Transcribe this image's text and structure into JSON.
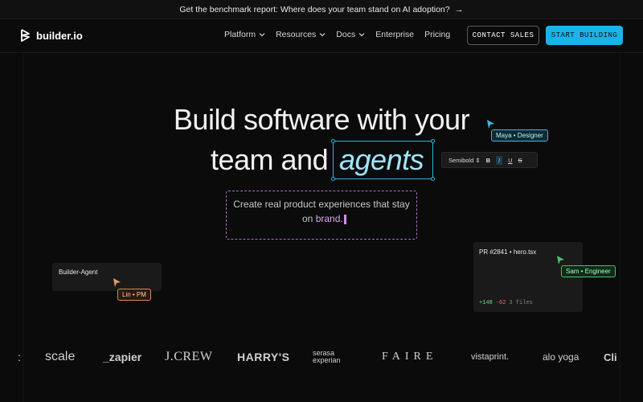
{
  "banner": {
    "text": "Get the benchmark report: Where does your team stand on AI adoption?",
    "arrow_icon": "arrow-right-icon"
  },
  "nav": {
    "brand": "builder.io",
    "items": [
      {
        "label": "Platform",
        "dropdown": true
      },
      {
        "label": "Resources",
        "dropdown": true
      },
      {
        "label": "Docs",
        "dropdown": true
      },
      {
        "label": "Enterprise",
        "dropdown": false
      },
      {
        "label": "Pricing",
        "dropdown": false
      }
    ],
    "contact_label": "CONTACT SALES",
    "start_label": "START BUILDING"
  },
  "hero": {
    "line1": "Build software with your",
    "line2_prefix": "team and",
    "highlight": "agents",
    "subtitle_line1": "Create real product experiences that stay",
    "subtitle_line2_prefix": "on",
    "subtitle_brand": "brand."
  },
  "collaborators": {
    "maya": "Maya • Designer",
    "lin": "Lin • PM",
    "sam": "Sam • Engineer"
  },
  "toolbar": {
    "font_weight": "Semibold",
    "bold": "B",
    "italic": "I",
    "underline": "U",
    "strike": "S"
  },
  "agent_card": {
    "title": "Builder-Agent"
  },
  "pr_card": {
    "title": "PR #2841 • hero.tsx",
    "additions": "+148",
    "deletions": "-62",
    "files": "3 files"
  },
  "logos": [
    "scale",
    "_zapier",
    "J.CREW",
    "HARRY'S",
    "serasa",
    "experian",
    "FAIRE",
    "vistaprint.",
    "alo yoga",
    "Cli"
  ],
  "colors": {
    "accent": "#18b4e8",
    "maya": "#3bb8dd",
    "lin": "#d98a5c",
    "sam": "#46c46c",
    "caret": "#d68cf5"
  }
}
